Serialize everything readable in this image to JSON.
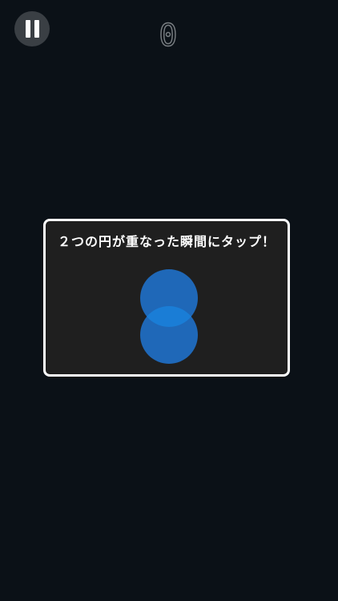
{
  "hud": {
    "score": "0"
  },
  "tutorial": {
    "instruction": "２つの円が重なった瞬間にタップ！"
  },
  "colors": {
    "background": "#0b1117",
    "panel": "#1f1f1f",
    "circle": "#1f68b8",
    "circle_overlap": "#1a7dd6"
  }
}
